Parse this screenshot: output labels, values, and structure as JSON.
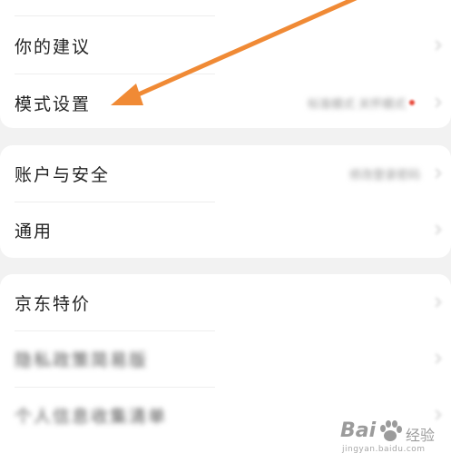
{
  "groups": [
    {
      "items": [
        {
          "label": "你的建议",
          "value": "",
          "blurred": false
        },
        {
          "label": "模式设置",
          "value": "标准模式 关怀模式",
          "blurred": false,
          "red_dot": true
        }
      ]
    },
    {
      "items": [
        {
          "label": "账户与安全",
          "value": "修改登录密码",
          "blurred": false
        },
        {
          "label": "通用",
          "value": "",
          "blurred": false
        }
      ]
    },
    {
      "items": [
        {
          "label": "京东特价",
          "value": "",
          "blurred": false
        },
        {
          "label": "隐私政策简易版",
          "value": "",
          "blurred": true
        },
        {
          "label": "个人信息收集清单",
          "value": "",
          "blurred": true
        }
      ]
    }
  ],
  "annotation": {
    "color": "#f08a35"
  },
  "watermark": {
    "brand": "Bai",
    "brand_cn": "经验",
    "url": "jingyan.baidu.com"
  },
  "colors": {
    "background": "#f2f2f2",
    "card": "#ffffff",
    "text": "#222222",
    "arrow": "#f08a35"
  }
}
